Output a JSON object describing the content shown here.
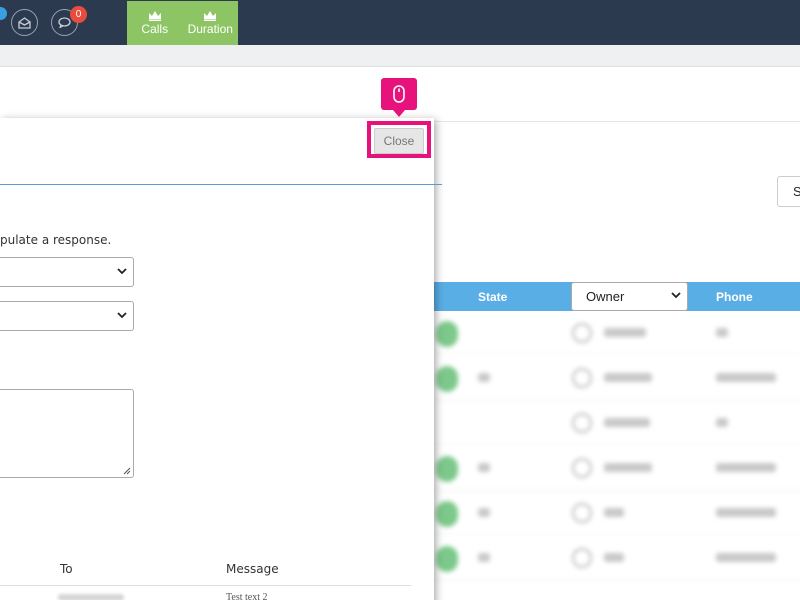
{
  "topbar": {
    "notification_count": "0",
    "tabs": [
      {
        "label": "Calls",
        "icon": "crown-icon"
      },
      {
        "label": "Duration",
        "icon": "crown-icon"
      }
    ]
  },
  "page": {
    "button_partial": "S",
    "table": {
      "col_state": "State",
      "owner_filter_value": "Owner",
      "col_phone": "Phone"
    }
  },
  "modal": {
    "close_label": "Close",
    "help_text": "pulate a response.",
    "message_table": {
      "col_to": "To",
      "col_message": "Message",
      "first_message": "Test text 2"
    }
  },
  "colors": {
    "nav_bg": "#2c3a4f",
    "tab_green": "#8dc565",
    "table_header": "#5aaee6",
    "highlight": "#e8127c",
    "badge": "#e74c3c"
  }
}
